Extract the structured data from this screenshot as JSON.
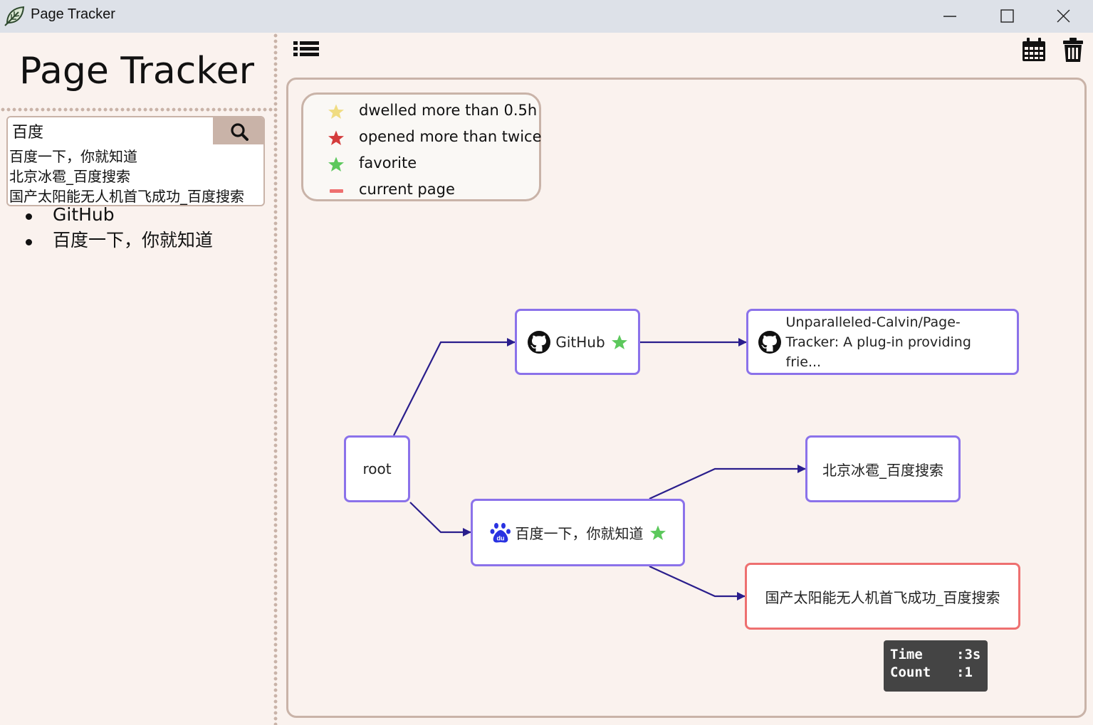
{
  "window": {
    "title": "Page Tracker"
  },
  "sidebar": {
    "title": "Page Tracker",
    "search": {
      "value": "百度",
      "button_icon": "search-icon"
    },
    "suggestions": [
      "百度一下，你就知道",
      "北京冰雹_百度搜索",
      "国产太阳能无人机首飞成功_百度搜索"
    ],
    "bookmarks": [
      "GitHub",
      "百度一下，你就知道"
    ]
  },
  "toolbar": {
    "left_icon": "list-icon",
    "right_icons": [
      "calendar-icon",
      "trash-icon"
    ]
  },
  "legend": [
    {
      "label": "dwelled more than 0.5h",
      "color": "#f0dc82",
      "marker": "star"
    },
    {
      "label": "opened more than twice",
      "color": "#d43c3c",
      "marker": "star"
    },
    {
      "label": "favorite",
      "color": "#5cc85c",
      "marker": "star"
    },
    {
      "label": "current page",
      "color": "#ee7070",
      "marker": "dash"
    }
  ],
  "graph": {
    "nodes": [
      {
        "id": "root",
        "label": "root"
      },
      {
        "id": "github",
        "label": "GitHub",
        "icon": "github-icon",
        "favorite": true
      },
      {
        "id": "repo",
        "label": "Unparalleled-Calvin/Page-Tracker: A plug-in providing frie...",
        "icon": "github-icon"
      },
      {
        "id": "baidu",
        "label": "百度一下，你就知道",
        "icon": "baidu-icon",
        "favorite": true
      },
      {
        "id": "hail",
        "label": "北京冰雹_百度搜索"
      },
      {
        "id": "drone",
        "label": "国产太阳能无人机首飞成功_百度搜索",
        "current": true
      }
    ],
    "edges": [
      [
        "root",
        "github"
      ],
      [
        "root",
        "baidu"
      ],
      [
        "github",
        "repo"
      ],
      [
        "baidu",
        "hail"
      ],
      [
        "baidu",
        "drone"
      ]
    ],
    "node_border_color": "#8b72ea",
    "current_border_color": "#ee7070",
    "edge_color": "#2a1e8c"
  },
  "tooltip": {
    "time_label": "Time",
    "time_value": ":3s",
    "count_label": "Count",
    "count_value": ":1"
  }
}
